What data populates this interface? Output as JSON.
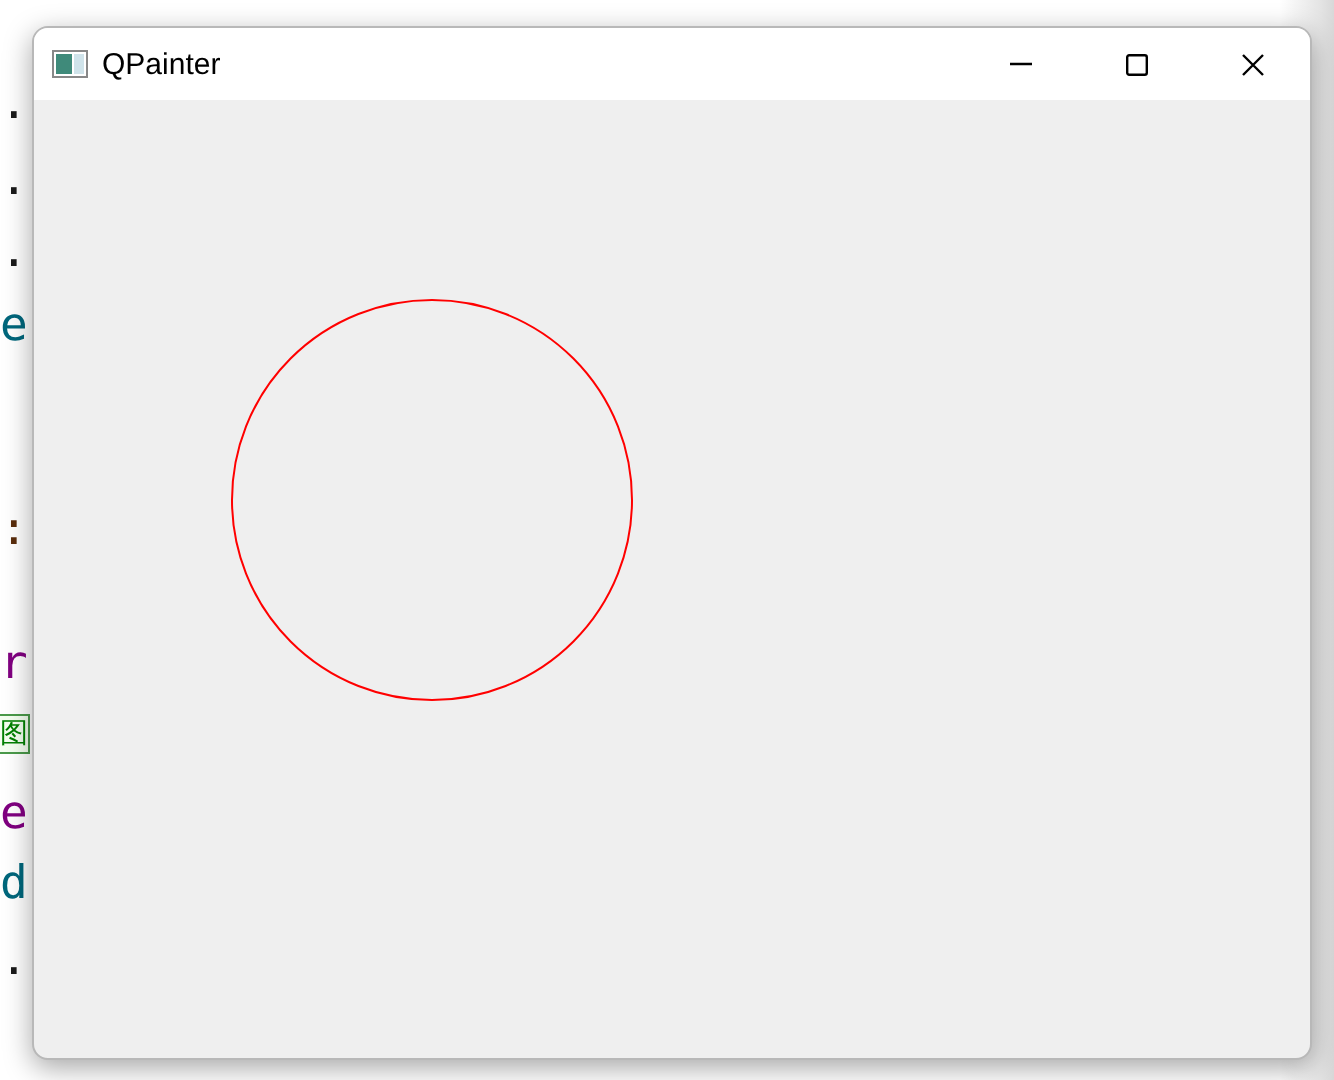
{
  "editor": {
    "fragments": [
      {
        "kind": "punct",
        "boxed": false,
        "text": "."
      },
      {
        "kind": "punct",
        "boxed": false,
        "text": "."
      },
      {
        "kind": "punct",
        "boxed": false,
        "text": "."
      },
      {
        "kind": "identifier",
        "boxed": false,
        "text": "e"
      },
      {
        "kind": "operator",
        "boxed": false,
        "text": ":"
      },
      {
        "kind": "keyword",
        "boxed": false,
        "text": "r"
      },
      {
        "kind": "comment",
        "boxed": true,
        "text": "图"
      },
      {
        "kind": "keyword",
        "boxed": false,
        "text": "e"
      },
      {
        "kind": "identifier",
        "boxed": false,
        "text": "d"
      },
      {
        "kind": "punct",
        "boxed": false,
        "text": "."
      }
    ]
  },
  "window": {
    "title": "QPainter",
    "controls": [
      {
        "kind": "minimize"
      },
      {
        "kind": "maximize"
      },
      {
        "kind": "close"
      }
    ],
    "canvas": {
      "shapes": [
        {
          "kind": "circle",
          "color": "#ff0000"
        }
      ]
    }
  }
}
